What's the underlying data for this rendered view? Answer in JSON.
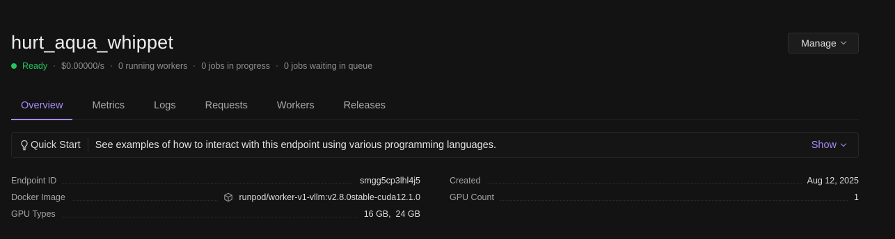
{
  "endpoint": {
    "name": "hurt_aqua_whippet",
    "status": "Ready",
    "cost": "$0.00000/s",
    "running_workers": "0 running workers",
    "jobs_in_progress": "0 jobs in progress",
    "jobs_in_queue": "0 jobs waiting in queue"
  },
  "header": {
    "manage_label": "Manage"
  },
  "tabs": [
    {
      "label": "Overview",
      "active": true
    },
    {
      "label": "Metrics"
    },
    {
      "label": "Logs"
    },
    {
      "label": "Requests"
    },
    {
      "label": "Workers"
    },
    {
      "label": "Releases"
    }
  ],
  "quickstart": {
    "label": "Quick Start",
    "text": "See examples of how to interact with this endpoint using various programming languages.",
    "show_label": "Show"
  },
  "details": {
    "endpoint_id": {
      "label": "Endpoint ID",
      "value": "smgg5cp3lhl4j5"
    },
    "docker_image": {
      "label": "Docker Image",
      "value": "runpod/worker-v1-vllm:v2.8.0stable-cuda12.1.0"
    },
    "gpu_types": {
      "label": "GPU Types",
      "value": "16 GB,  24 GB"
    },
    "created": {
      "label": "Created",
      "value": "Aug 12, 2025"
    },
    "gpu_count": {
      "label": "GPU Count",
      "value": "1"
    }
  },
  "colors": {
    "accent": "#a68bf7",
    "ready": "#22c55e",
    "background": "#131313"
  },
  "icons": {
    "status": "status-dot",
    "manage": "chevron-down-icon",
    "quickstart": "lightbulb-icon",
    "show": "chevron-down-icon",
    "docker": "package-icon"
  }
}
